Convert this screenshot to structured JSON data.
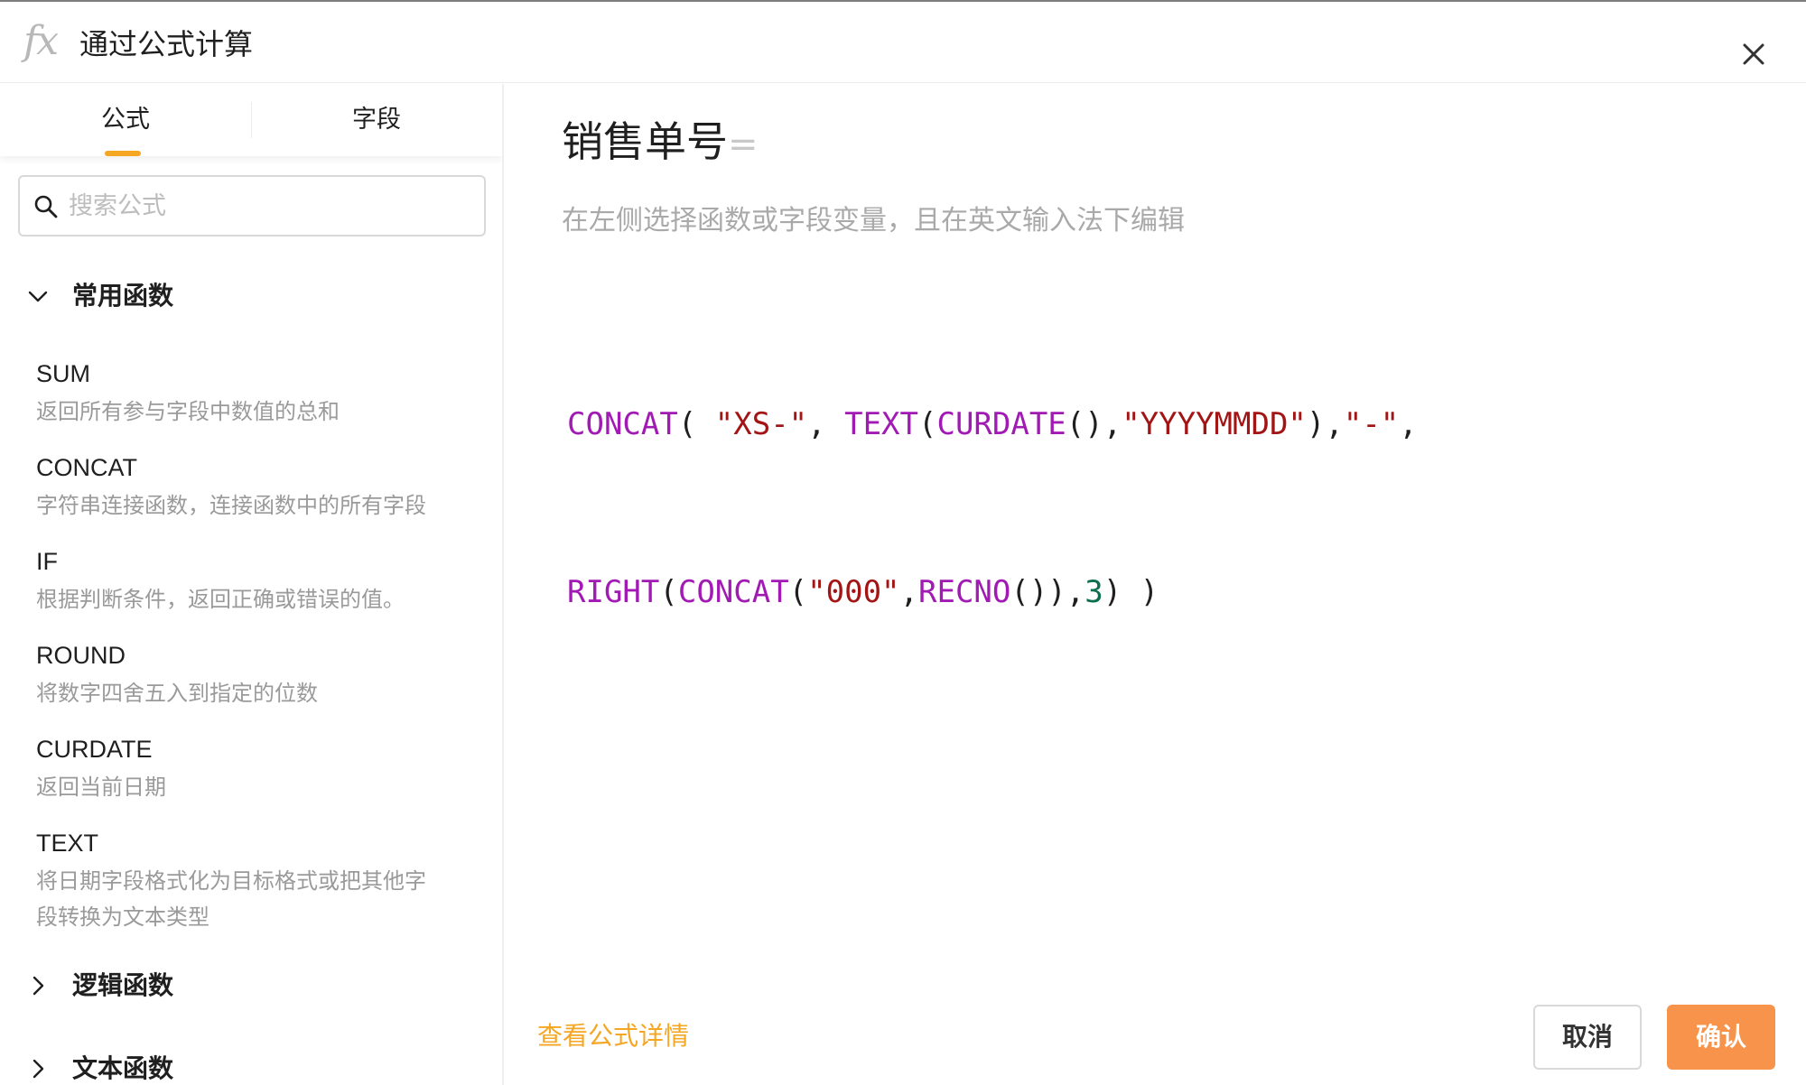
{
  "header": {
    "icon_text": "fx",
    "title": "通过公式计算"
  },
  "tabs": [
    {
      "label": "公式",
      "active": true
    },
    {
      "label": "字段",
      "active": false
    }
  ],
  "search": {
    "placeholder": "搜索公式",
    "value": ""
  },
  "groups": {
    "common": {
      "label": "常用函数",
      "expanded": true,
      "items": [
        {
          "name": "SUM",
          "desc": "返回所有参与字段中数值的总和"
        },
        {
          "name": "CONCAT",
          "desc": "字符串连接函数，连接函数中的所有字段"
        },
        {
          "name": "IF",
          "desc": "根据判断条件，返回正确或错误的值。"
        },
        {
          "name": "ROUND",
          "desc": "将数字四舍五入到指定的位数"
        },
        {
          "name": "CURDATE",
          "desc": "返回当前日期"
        },
        {
          "name": "TEXT",
          "desc_line1": "将日期字段格式化为目标格式或把其他字",
          "desc_line2": "段转换为文本类型"
        }
      ]
    },
    "logic": {
      "label": "逻辑函数",
      "expanded": false
    },
    "text": {
      "label": "文本函数",
      "expanded": false
    }
  },
  "editor": {
    "field_name": "销售单号",
    "equals": "=",
    "hint": "在左侧选择函数或字段变量，且在英文输入法下编辑",
    "line1": [
      {
        "t": "fn",
        "v": "CONCAT"
      },
      {
        "t": "punc",
        "v": "( "
      },
      {
        "t": "str",
        "v": "\"XS-\""
      },
      {
        "t": "punc",
        "v": ", "
      },
      {
        "t": "fn",
        "v": "TEXT"
      },
      {
        "t": "punc",
        "v": "("
      },
      {
        "t": "fn",
        "v": "CURDATE"
      },
      {
        "t": "punc",
        "v": "(),"
      },
      {
        "t": "str",
        "v": "\"YYYYMMDD\""
      },
      {
        "t": "punc",
        "v": "),"
      },
      {
        "t": "str",
        "v": "\"-\""
      },
      {
        "t": "punc",
        "v": ","
      }
    ],
    "line2": [
      {
        "t": "fn",
        "v": "RIGHT"
      },
      {
        "t": "punc",
        "v": "("
      },
      {
        "t": "fn",
        "v": "CONCAT"
      },
      {
        "t": "punc",
        "v": "("
      },
      {
        "t": "str",
        "v": "\"000\""
      },
      {
        "t": "punc",
        "v": ","
      },
      {
        "t": "fn",
        "v": "RECNO"
      },
      {
        "t": "punc",
        "v": "()),"
      },
      {
        "t": "num",
        "v": "3"
      },
      {
        "t": "punc",
        "v": ") )"
      }
    ]
  },
  "footer": {
    "detail_link": "查看公式详情",
    "cancel_label": "取消",
    "confirm_label": "确认"
  },
  "colors": {
    "accent": "#f5a623",
    "confirm_bg": "#f7934a",
    "function_token": "#a21ab4",
    "string_token": "#a31515",
    "number_token": "#0b6e4f"
  }
}
